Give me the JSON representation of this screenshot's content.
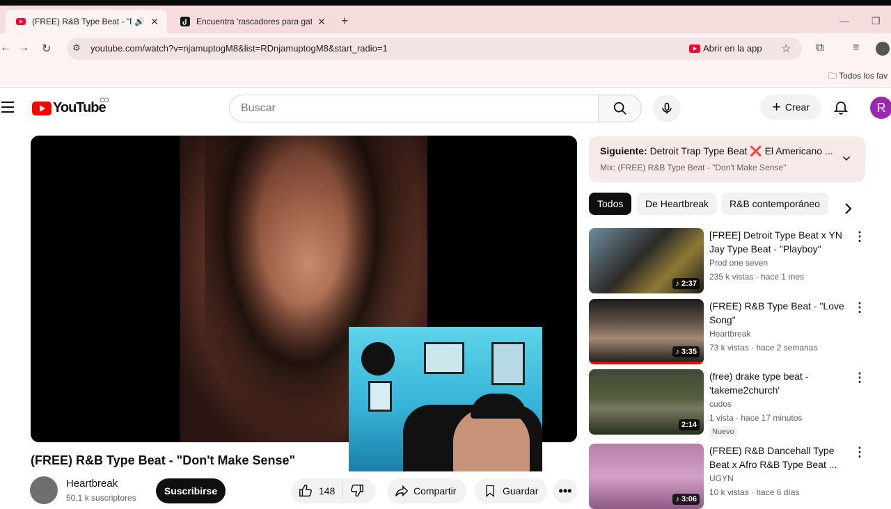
{
  "browser": {
    "tabs": [
      {
        "title": "(FREE) R&B Type Beat - \"Do",
        "favicon": "youtube-icon",
        "audio": true
      },
      {
        "title": "Encuentra 'rascadores para gat",
        "favicon": "tiktok-icon"
      }
    ],
    "url": "youtube.com/watch?v=njamuptogM8&list=RDnjamuptogM8&start_radio=1",
    "open_in_app": "Abrir en la app",
    "bookmarks_label": "Todos los fav"
  },
  "youtube": {
    "country_code": "CO",
    "logo_text": "YouTube",
    "search_placeholder": "Buscar",
    "create_label": "Crear",
    "avatar_letter": "R"
  },
  "video": {
    "title": "(FREE) R&B Type Beat - \"Don't Make Sense\"",
    "channel": "Heartbreak",
    "subscribers": "50,1 k suscriptores",
    "subscribe_label": "Suscribirse",
    "likes": "148",
    "share_label": "Compartir",
    "save_label": "Guardar"
  },
  "up_next": {
    "label": "Siguiente:",
    "title": "Detroit Trap Type Beat ❌ El Americano ...",
    "mix": "Mix: (FREE) R&B Type Beat - \"Don't Make Sense\""
  },
  "chips": [
    "Todos",
    "De Heartbreak",
    "R&B contemporáneo"
  ],
  "recommendations": [
    {
      "title": "[FREE] Detroit Type Beat x YN Jay Type Beat - \"Playboy\"",
      "channel": "Prod one seven",
      "meta": "235 k vistas · hace 1 mes",
      "duration": "2:37",
      "badge": ""
    },
    {
      "title": "(FREE) R&B Type Beat - \"Love Song\"",
      "channel": "Heartbreak",
      "meta": "73 k vistas · hace 2 semanas",
      "duration": "3:35",
      "badge": ""
    },
    {
      "title": "(free) drake type beat - 'takeme2church'",
      "channel": "cudos",
      "meta": "1 vista · hace 17 minutos",
      "duration": "2:14",
      "badge": "Nuevo"
    },
    {
      "title": "(FREE) R&B Dancehall Type Beat x Afro R&B Type Beat ...",
      "channel": "UGYN",
      "meta": "10 k vistas · hace 6 días",
      "duration": "3:06",
      "badge": ""
    }
  ],
  "colors": {
    "brand_red": "#ff0000",
    "tab_bg": "#f6dcdc",
    "avatar_purple": "#9c27b0"
  }
}
